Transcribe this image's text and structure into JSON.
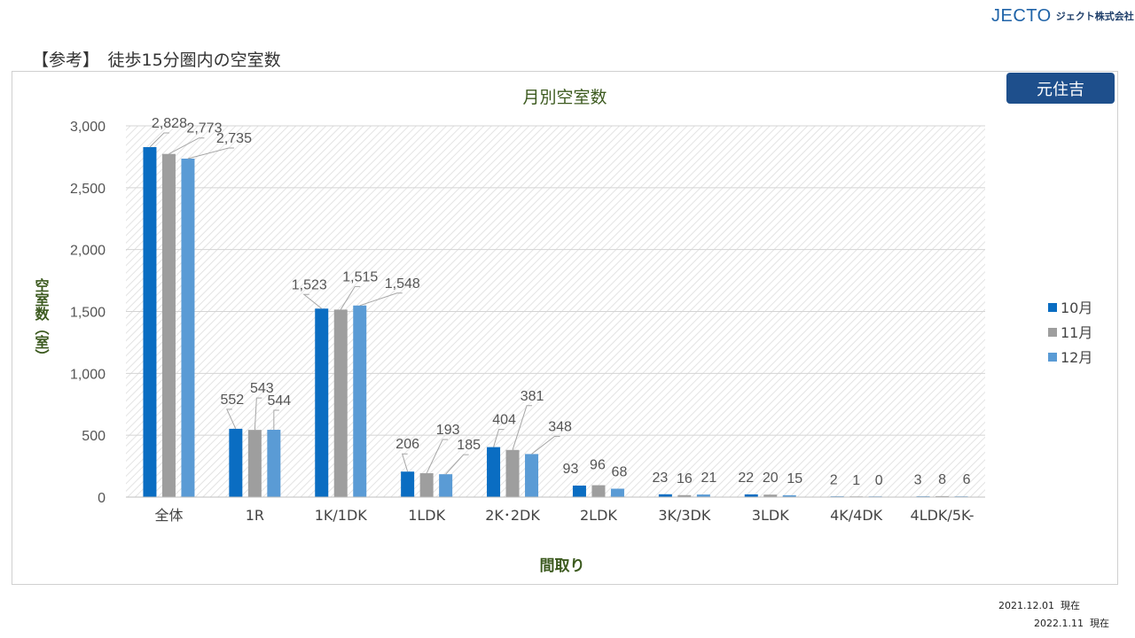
{
  "header": {
    "logo": "JECTO",
    "company": "ジェクト株式会社",
    "slide_title": "【参考】　徒歩15分圏内の空室数"
  },
  "badge": "元住吉",
  "footer": {
    "date1": "2021.12.01  現在",
    "date2": "2022.1.11  現在"
  },
  "colors": {
    "s10": "#0a6dc2",
    "s11": "#9e9e9e",
    "s12": "#5a9bd5",
    "title": "#3c5a1f",
    "badge": "#1e4f8c"
  },
  "chart_data": {
    "type": "bar",
    "title": "月別空室数",
    "xlabel": "間取り",
    "ylabel": "空室数（室）",
    "ylim": [
      0,
      3000
    ],
    "yticks": [
      "0",
      "500",
      "1,000",
      "1,500",
      "2,000",
      "2,500",
      "3,000"
    ],
    "categories": [
      "全体",
      "1R",
      "1K/1DK",
      "1LDK",
      "2K･2DK",
      "2LDK",
      "3K/3DK",
      "3LDK",
      "4K/4DK",
      "4LDK/5K-"
    ],
    "series": [
      {
        "name": "10月",
        "values": [
          2828,
          552,
          1523,
          206,
          404,
          93,
          23,
          22,
          2,
          3
        ]
      },
      {
        "name": "11月",
        "values": [
          2773,
          543,
          1515,
          193,
          381,
          96,
          16,
          20,
          1,
          8
        ]
      },
      {
        "name": "12月",
        "values": [
          2735,
          544,
          1548,
          185,
          348,
          68,
          21,
          15,
          0,
          6
        ]
      }
    ],
    "data_labels": [
      [
        "2,828",
        "552",
        "1,523",
        "206",
        "404",
        "93",
        "23",
        "22",
        "2",
        "3"
      ],
      [
        "2,773",
        "543",
        "1,515",
        "193",
        "381",
        "96",
        "16",
        "20",
        "1",
        "8"
      ],
      [
        "2,735",
        "544",
        "1,548",
        "185",
        "348",
        "68",
        "21",
        "15",
        "0",
        "6"
      ]
    ],
    "legend": "right",
    "grid": true
  }
}
